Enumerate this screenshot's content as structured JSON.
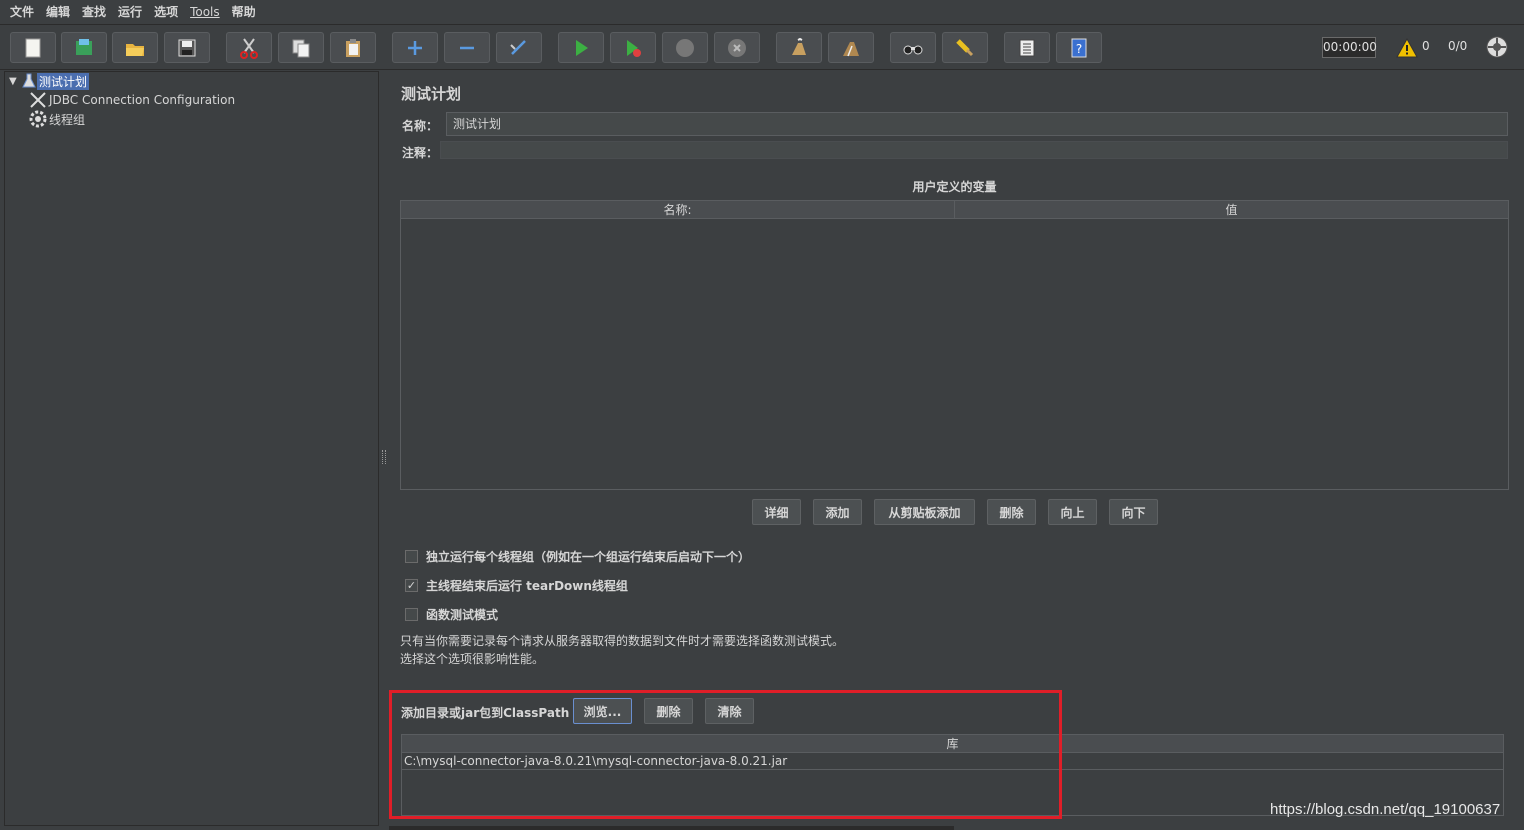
{
  "menu": [
    "文件",
    "编辑",
    "查找",
    "运行",
    "选项",
    "Tools",
    "帮助"
  ],
  "toolbar": {
    "buttons": [
      "new-icon",
      "templates-icon",
      "open-icon",
      "save-icon",
      "cut-icon",
      "copy-icon",
      "paste-icon",
      "expand-icon",
      "collapse-icon",
      "toggle-icon",
      "start-icon",
      "start-no-pause-icon",
      "stop-icon",
      "shutdown-icon",
      "clear-icon",
      "clear-all-icon",
      "search-icon",
      "reset-search-icon",
      "function-helper-icon",
      "help-icon"
    ],
    "timer": "00:00:00",
    "warning_count": "0",
    "thread_count": "0/0"
  },
  "tree": {
    "items": [
      {
        "label": "测试计划"
      },
      {
        "label": "JDBC Connection Configuration"
      },
      {
        "label": "线程组"
      }
    ]
  },
  "test_plan": {
    "title": "测试计划",
    "name_label": "名称：",
    "name_value": "测试计划",
    "comment_label": "注释：",
    "udv_title": "用户定义的变量",
    "udv_col_name": "名称:",
    "udv_col_value": "值",
    "buttons": {
      "detail": "详细",
      "add": "添加",
      "add_clipboard": "从剪贴板添加",
      "delete": "删除",
      "up": "向上",
      "down": "向下"
    },
    "checkbox_serial": "独立运行每个线程组（例如在一个组运行结束后启动下一个）",
    "checkbox_teardown": "主线程结束后运行 tearDown线程组",
    "checkbox_functional": "函数测试模式",
    "note_line1": "只有当你需要记录每个请求从服务器取得的数据到文件时才需要选择函数测试模式。",
    "note_line2": "选择这个选项很影响性能。",
    "classpath_label": "添加目录或jar包到ClassPath",
    "browse_button": "浏览...",
    "delete_button": "删除",
    "clear_button": "清除",
    "lib_header": "库",
    "lib_rows": [
      "C:\\mysql-connector-java-8.0.21\\mysql-connector-java-8.0.21.jar"
    ]
  },
  "watermark": "https://blog.csdn.net/qq_19100637",
  "colors": {
    "background": "#3c3f41",
    "selection": "#4b6eaf",
    "highlight": "#e01e28"
  }
}
